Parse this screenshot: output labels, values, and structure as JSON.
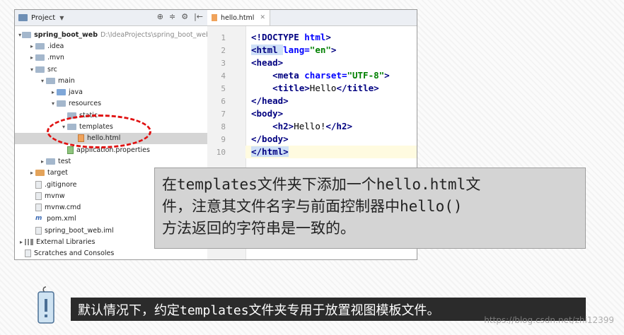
{
  "project_panel": {
    "title": "Project",
    "tools": [
      "⊕",
      "≑",
      "⚙",
      "|←"
    ],
    "tree": [
      {
        "label": "spring_boot_web",
        "path": "D:\\IdeaProjects\\spring_boot_web",
        "bold": true,
        "arrow": "▾",
        "indent": 0,
        "icon": "folder",
        "icon_name": "project-folder-icon"
      },
      {
        "label": ".idea",
        "arrow": "▸",
        "indent": 1,
        "icon": "folder",
        "icon_name": "folder-icon"
      },
      {
        "label": ".mvn",
        "arrow": "▸",
        "indent": 1,
        "icon": "folder",
        "icon_name": "folder-icon"
      },
      {
        "label": "src",
        "arrow": "▾",
        "indent": 1,
        "icon": "folder",
        "icon_name": "folder-icon"
      },
      {
        "label": "main",
        "arrow": "▾",
        "indent": 2,
        "icon": "folder",
        "icon_name": "folder-icon"
      },
      {
        "label": "java",
        "arrow": "▸",
        "indent": 3,
        "icon": "folder-blue",
        "icon_name": "source-folder-icon"
      },
      {
        "label": "resources",
        "arrow": "▾",
        "indent": 3,
        "icon": "folder",
        "icon_name": "resources-folder-icon"
      },
      {
        "label": "static",
        "arrow": "",
        "indent": 4,
        "icon": "folder",
        "icon_name": "folder-icon"
      },
      {
        "label": "templates",
        "arrow": "▾",
        "indent": 4,
        "icon": "folder",
        "icon_name": "folder-icon"
      },
      {
        "label": "hello.html",
        "arrow": "",
        "indent": 5,
        "icon": "html",
        "icon_name": "html-file-icon",
        "selected": true
      },
      {
        "label": "application.properties",
        "arrow": "",
        "indent": 4,
        "icon": "props",
        "icon_name": "properties-file-icon"
      },
      {
        "label": "test",
        "arrow": "▸",
        "indent": 2,
        "icon": "folder",
        "icon_name": "folder-icon"
      },
      {
        "label": "target",
        "arrow": "▸",
        "indent": 1,
        "icon": "folder-orange",
        "icon_name": "excluded-folder-icon"
      },
      {
        "label": ".gitignore",
        "arrow": "",
        "indent": 1,
        "icon": "file",
        "icon_name": "file-icon"
      },
      {
        "label": "mvnw",
        "arrow": "",
        "indent": 1,
        "icon": "file",
        "icon_name": "file-icon"
      },
      {
        "label": "mvnw.cmd",
        "arrow": "",
        "indent": 1,
        "icon": "file",
        "icon_name": "file-icon"
      },
      {
        "label": "pom.xml",
        "arrow": "",
        "indent": 1,
        "icon": "m",
        "icon_name": "maven-file-icon"
      },
      {
        "label": "spring_boot_web.iml",
        "arrow": "",
        "indent": 1,
        "icon": "file",
        "icon_name": "file-icon"
      },
      {
        "label": "External Libraries",
        "arrow": "▸",
        "indent": 0,
        "icon": "libs",
        "icon_name": "libraries-icon"
      },
      {
        "label": "Scratches and Consoles",
        "arrow": "",
        "indent": 0,
        "icon": "file",
        "icon_name": "scratches-icon"
      }
    ]
  },
  "editor": {
    "tab_label": "hello.html",
    "line_numbers": [
      "1",
      "2",
      "3",
      "4",
      "5",
      "6",
      "7",
      "8",
      "9",
      "10"
    ],
    "lines": [
      [
        {
          "t": "<!DOCTYPE ",
          "c": "tg"
        },
        {
          "t": "html",
          "c": "at"
        },
        {
          "t": ">",
          "c": "tg"
        }
      ],
      [
        {
          "t": "<html ",
          "c": "tg mk"
        },
        {
          "t": "lang=",
          "c": "at"
        },
        {
          "t": "\"en\"",
          "c": "sv"
        },
        {
          "t": ">",
          "c": "tg"
        }
      ],
      [
        {
          "t": "<head>",
          "c": "tg"
        }
      ],
      [
        {
          "t": "    "
        },
        {
          "t": "<meta ",
          "c": "tg"
        },
        {
          "t": "charset=",
          "c": "at"
        },
        {
          "t": "\"UTF-8\"",
          "c": "sv"
        },
        {
          "t": ">",
          "c": "tg"
        }
      ],
      [
        {
          "t": "    "
        },
        {
          "t": "<title>",
          "c": "tg"
        },
        {
          "t": "Hello"
        },
        {
          "t": "</title>",
          "c": "tg"
        }
      ],
      [
        {
          "t": "</head>",
          "c": "tg"
        }
      ],
      [
        {
          "t": "<body>",
          "c": "tg"
        }
      ],
      [
        {
          "t": "    "
        },
        {
          "t": "<h2>",
          "c": "tg"
        },
        {
          "t": "Hello!"
        },
        {
          "t": "</h2>",
          "c": "tg"
        }
      ],
      [
        {
          "t": "</body>",
          "c": "tg"
        }
      ],
      [
        {
          "t": "</html>",
          "c": "tg mk"
        }
      ]
    ]
  },
  "callout": {
    "line1": "在templates文件夹下添加一个hello.html文",
    "line2": "件，注意其文件名字与前面控制器中hello()",
    "line3": "方法返回的字符串是一致的。"
  },
  "note": {
    "icon_name": "info-tag-icon",
    "text": "默认情况下，约定templates文件夹专用于放置视图模板文件。"
  },
  "watermark": "https://blog.csdn.net/zhi12399"
}
